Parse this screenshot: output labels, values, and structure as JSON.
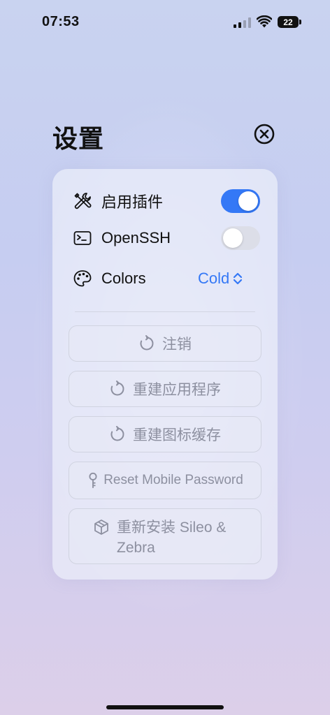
{
  "status_bar": {
    "time": "07:53",
    "battery_level": "22",
    "icons": [
      "signal-icon",
      "wifi-icon",
      "battery-icon"
    ]
  },
  "header": {
    "title": "设置",
    "close_icon": "close-circle-icon"
  },
  "settings": {
    "plugins": {
      "label": "启用插件",
      "icon": "tools-icon",
      "enabled": true
    },
    "openssh": {
      "label": "OpenSSH",
      "icon": "terminal-icon",
      "enabled": false
    },
    "colors": {
      "label": "Colors",
      "icon": "palette-icon",
      "value": "Cold"
    }
  },
  "actions": [
    {
      "label": "注销",
      "icon": "refresh-icon"
    },
    {
      "label": "重建应用程序",
      "icon": "refresh-icon"
    },
    {
      "label": "重建图标缓存",
      "icon": "refresh-icon"
    },
    {
      "label": "Reset Mobile Password",
      "icon": "key-icon"
    },
    {
      "label": "重新安装 Sileo & Zebra",
      "icon": "package-icon"
    }
  ],
  "colors": {
    "accent": "#3478f6",
    "disabled_text": "#8d90a0"
  }
}
